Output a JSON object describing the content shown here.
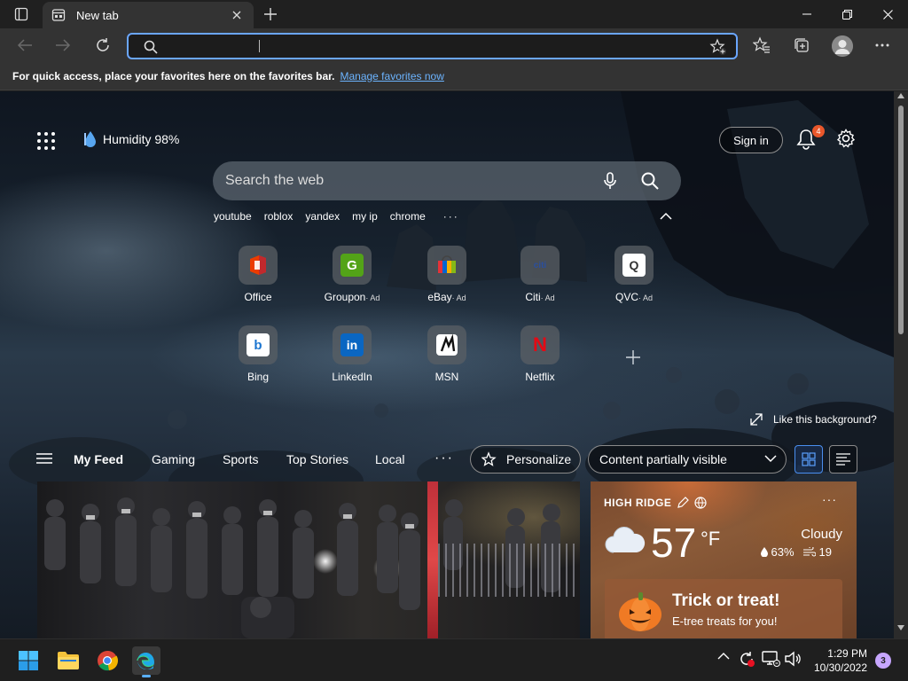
{
  "tab": {
    "title": "New tab"
  },
  "address_bar": {
    "value": "",
    "placeholder": ""
  },
  "favorites_bar": {
    "message": "For quick access, place your favorites here on the favorites bar.",
    "link": "Manage favorites now"
  },
  "ntp": {
    "weather_mini": "Humidity 98%",
    "sign_in": "Sign in",
    "notifications_count": "4",
    "search_placeholder": "Search the web",
    "trending": [
      "youtube",
      "roblox",
      "yandex",
      "my ip",
      "chrome"
    ],
    "tiles": [
      {
        "name": "Office",
        "ad": ""
      },
      {
        "name": "Groupon",
        "ad": "· Ad"
      },
      {
        "name": "eBay",
        "ad": "· Ad"
      },
      {
        "name": "Citi",
        "ad": "· Ad"
      },
      {
        "name": "QVC",
        "ad": "· Ad"
      },
      {
        "name": "Bing",
        "ad": ""
      },
      {
        "name": "LinkedIn",
        "ad": ""
      },
      {
        "name": "MSN",
        "ad": ""
      },
      {
        "name": "Netflix",
        "ad": ""
      }
    ],
    "like_background": "Like this background?",
    "feed_nav": [
      "My Feed",
      "Gaming",
      "Sports",
      "Top Stories",
      "Local"
    ],
    "personalize": "Personalize",
    "content_visibility": "Content partially visible"
  },
  "weather_card": {
    "location": "HIGH RIDGE",
    "temp": "57",
    "unit": "°F",
    "condition": "Cloudy",
    "precip": "63%",
    "wind": "19"
  },
  "promo": {
    "title": "Trick or treat!",
    "subtitle": "E-tree treats for you!"
  },
  "taskbar": {
    "time": "1:29 PM",
    "date": "10/30/2022",
    "notifications": "3"
  },
  "colors": {
    "accent": "#6aa6ff",
    "badge": "#e9572b",
    "chrome_bg": "#202020",
    "toolbar_bg": "#333333"
  }
}
